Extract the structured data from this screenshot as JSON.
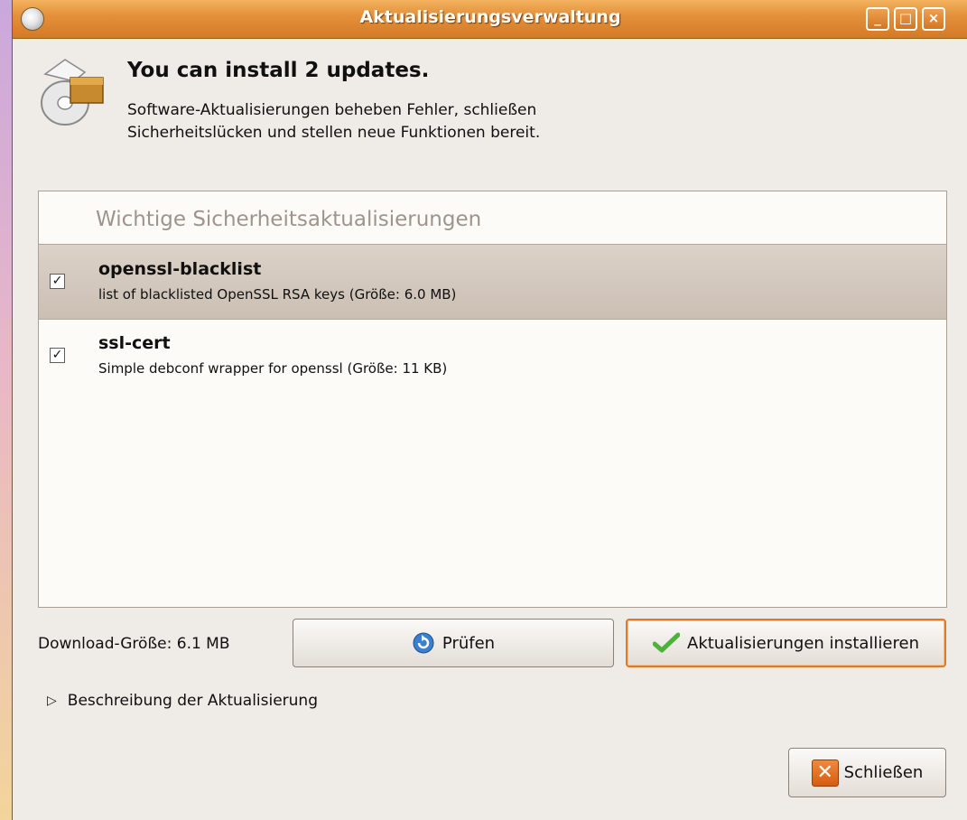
{
  "window": {
    "title": "Aktualisierungsverwaltung",
    "controls": {
      "minimize": "_",
      "maximize": "□",
      "close": "×"
    }
  },
  "header": {
    "headline": "You can install 2 updates.",
    "subtitle": "Software-Aktualisierungen beheben Fehler, schließen Sicherheitslücken und stellen neue Funktionen bereit."
  },
  "update_list": {
    "section_title": "Wichtige Sicherheitsaktualisierungen",
    "items": [
      {
        "name": "openssl-blacklist",
        "description": "list of blacklisted OpenSSL RSA keys (Größe: 6.0 MB)",
        "checked": true,
        "selected": true
      },
      {
        "name": "ssl-cert",
        "description": "Simple debconf wrapper for openssl (Größe: 11 KB)",
        "checked": true,
        "selected": false
      }
    ]
  },
  "download_size_label": "Download-Größe: 6.1 MB",
  "buttons": {
    "check": {
      "label": "Prüfen",
      "icon": "refresh-icon"
    },
    "install": {
      "label": "Aktualisierungen installieren",
      "icon": "checkmark-icon"
    },
    "close": {
      "label": "Schließen",
      "icon": "close-x-icon"
    }
  },
  "expander": {
    "label": "Beschreibung der Aktualisierung",
    "expanded": false
  },
  "colors": {
    "titlebar": "#e4903a",
    "window_bg": "#efebe7",
    "list_bg": "#fdfbf8",
    "selected_row": "#d4c9bf",
    "focus_border": "#e07a2a"
  }
}
